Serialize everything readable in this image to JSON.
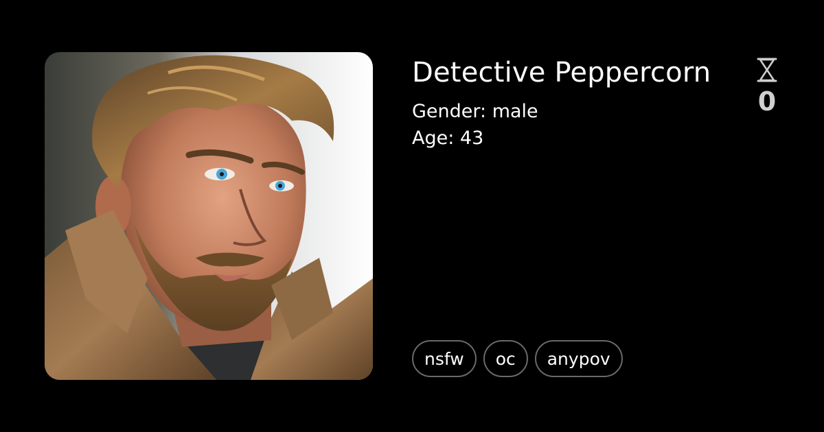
{
  "character": {
    "name": "Detective Peppercorn",
    "gender_line": "Gender: male",
    "age_line": "Age: 43",
    "counter_icon": "hourglass-icon",
    "counter_value": "0",
    "tags": [
      "nsfw",
      "oc",
      "anypov"
    ]
  },
  "colors": {
    "background": "#000000",
    "text": "#ffffff",
    "counter": "#cfcfcf",
    "tag_border": "#6a6a6a"
  }
}
